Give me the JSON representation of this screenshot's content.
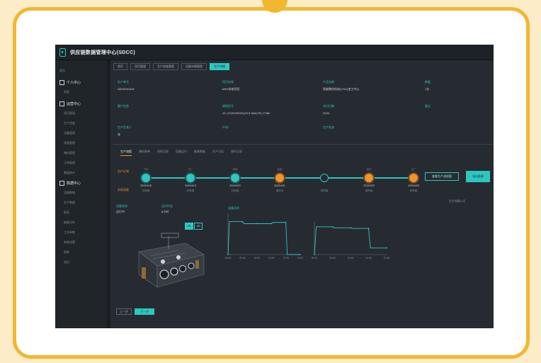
{
  "app": {
    "title": "供应链数据管理中心(SDCC)"
  },
  "sidebar": {
    "items": [
      {
        "label": "首页",
        "kind": "item"
      },
      {
        "label": "个人中心",
        "kind": "group"
      },
      {
        "label": "消息",
        "kind": "sub"
      },
      {
        "label": "运营中心",
        "kind": "group"
      },
      {
        "label": "项目管理",
        "kind": "sub"
      },
      {
        "label": "生产进度",
        "kind": "sub"
      },
      {
        "label": "设备管理",
        "kind": "sub"
      },
      {
        "label": "质量管理",
        "kind": "sub"
      },
      {
        "label": "物料管理",
        "kind": "sub"
      },
      {
        "label": "订单管理",
        "kind": "sub"
      },
      {
        "label": "数据统计",
        "kind": "sub"
      },
      {
        "label": "数据中心",
        "kind": "group"
      },
      {
        "label": "设备数据",
        "kind": "sub"
      },
      {
        "label": "生产数据",
        "kind": "sub"
      },
      {
        "label": "报表",
        "kind": "sub"
      },
      {
        "label": "能耗分析",
        "kind": "sub"
      },
      {
        "label": "工艺参数",
        "kind": "sub"
      },
      {
        "label": "系统设置",
        "kind": "sub"
      },
      {
        "label": "帮助",
        "kind": "sub"
      },
      {
        "label": "退出",
        "kind": "sub"
      }
    ]
  },
  "tabs": [
    {
      "label": "首页",
      "active": false
    },
    {
      "label": "项目管理",
      "active": false
    },
    {
      "label": "生产进度管理",
      "active": false
    },
    {
      "label": "设备详情管理",
      "active": false
    },
    {
      "label": "生产详情",
      "active": true
    }
  ],
  "info": [
    {
      "key": "生产单号",
      "value": "SD20230418"
    },
    {
      "key": "项目名称",
      "value": "MES系统项目"
    },
    {
      "key": "产品名称",
      "value": "智能数控机床(CNC)加工中心"
    },
    {
      "key": "数量",
      "value": "1台"
    },
    {
      "key": "客户信息",
      "value": ""
    },
    {
      "key": "规格型号",
      "value": "XC-1S/2S/3S/4S(1S:5.5kW,2S) 1*380"
    },
    {
      "key": "交付日期",
      "value": "2023"
    },
    {
      "key": "备注",
      "value": ""
    },
    {
      "key": "生产负责人",
      "value": "张"
    },
    {
      "key": "产线",
      "value": ""
    },
    {
      "key": "生产状态",
      "value": ""
    }
  ],
  "subtabs": [
    {
      "label": "生产流程",
      "active": true
    },
    {
      "label": "物料清单",
      "active": false
    },
    {
      "label": "质检记录",
      "active": false
    },
    {
      "label": "设备运行",
      "active": false
    },
    {
      "label": "能耗数据",
      "active": false
    },
    {
      "label": "生产日志",
      "active": false
    },
    {
      "label": "操作记录",
      "active": false
    }
  ],
  "timeline": {
    "labels": {
      "plan": "生产计划",
      "actual": "实际进度"
    },
    "nodes": [
      {
        "top": "下料",
        "date": "2023/4/18",
        "sub": "已完成",
        "color": "teal"
      },
      {
        "top": "加工",
        "date": "2023/4/19",
        "sub": "已完成",
        "color": "teal"
      },
      {
        "top": "焊接",
        "date": "2023/4/20",
        "sub": "已完成",
        "color": "teal"
      },
      {
        "top": "装配",
        "date": "2023/4/21",
        "sub": "进行中",
        "color": "orange"
      },
      {
        "top": "",
        "date": "",
        "sub": "待开始",
        "color": "hollow"
      },
      {
        "top": "调试",
        "date": "2023/4/23",
        "sub": "待开始",
        "color": "orange"
      },
      {
        "top": "出厂",
        "date": "2023/4/25",
        "sub": "待开始",
        "color": "orange"
      }
    ],
    "buttons": {
      "view": "查看生产流程图",
      "export": "导出报表"
    },
    "note": "生产周期 8天"
  },
  "stats": [
    {
      "key": "设备状态",
      "value": "运行中"
    },
    {
      "key": "运行时长",
      "value": "6小时"
    }
  ],
  "model_toggle": {
    "a": "3D",
    "b": "2D"
  },
  "chart_data": [
    {
      "type": "line",
      "title": "设备功率",
      "x": [
        "08:00",
        "09:00",
        "10:00",
        "11:00",
        "12:00",
        "13:00"
      ],
      "series": [
        {
          "values": [
            0,
            80,
            75,
            75,
            78,
            0
          ]
        }
      ],
      "ylim": [
        0,
        100
      ]
    },
    {
      "type": "line",
      "title": "",
      "x": [
        "08:00",
        "09:00",
        "10:00",
        "11:00",
        "12:00"
      ],
      "series": [
        {
          "values": [
            0,
            85,
            82,
            80,
            20
          ]
        }
      ],
      "ylim": [
        0,
        100
      ]
    }
  ],
  "bottom_buttons": {
    "left": "上一步",
    "right": "下一步"
  },
  "colors": {
    "accent": "#2ec7c0",
    "warn": "#f3932b",
    "bg": "#262b31"
  }
}
